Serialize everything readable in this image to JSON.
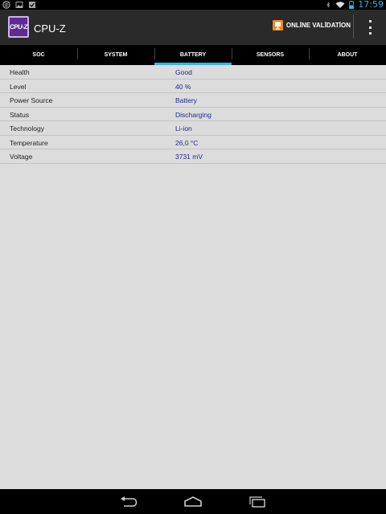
{
  "status_bar": {
    "time": "17:59",
    "colors": {
      "clock": "#33b5e5",
      "background": "#000000"
    }
  },
  "action_bar": {
    "app_title": "CPU-Z",
    "logo_text": "CPU-Z",
    "validation_label": "ONLİNE VALİDATİON",
    "colors": {
      "logo": "#5b2c91",
      "validation_icon": "#f08a1c"
    }
  },
  "tabs": [
    {
      "label": "SOC",
      "active": false
    },
    {
      "label": "SYSTEM",
      "active": false
    },
    {
      "label": "BATTERY",
      "active": true
    },
    {
      "label": "SENSORS",
      "active": false
    },
    {
      "label": "ABOUT",
      "active": false
    }
  ],
  "battery": {
    "rows": [
      {
        "label": "Health",
        "value": "Good"
      },
      {
        "label": "Level",
        "value": "40 %"
      },
      {
        "label": "Power Source",
        "value": "Battery"
      },
      {
        "label": "Status",
        "value": "Discharging"
      },
      {
        "label": "Technology",
        "value": "Li-ion"
      },
      {
        "label": "Temperature",
        "value": "26,0 °C"
      },
      {
        "label": "Voltage",
        "value": "3731 mV"
      }
    ],
    "colors": {
      "value_text": "#1f2a8c",
      "tab_indicator": "#33b5e5"
    }
  },
  "nav_bar": {
    "buttons": [
      "back-icon",
      "home-icon",
      "recent-apps-icon"
    ]
  }
}
